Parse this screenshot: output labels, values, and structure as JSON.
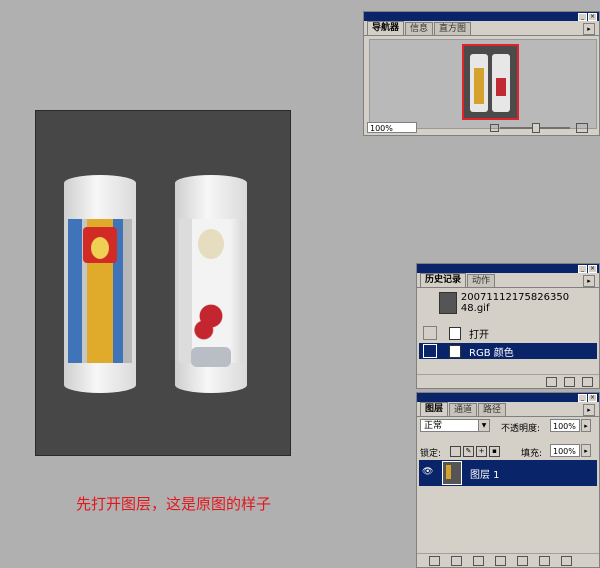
{
  "caption": "先打开图层，这是原图的样子",
  "navigator": {
    "tabs": [
      "导航器",
      "信息",
      "直方图"
    ],
    "zoom_value": "100%"
  },
  "history": {
    "tabs": [
      "历史记录",
      "动作"
    ],
    "snapshot_label": "20071112175826350​48.gif",
    "steps": [
      "打开",
      "RGB 颜色"
    ],
    "selected_step": "RGB 颜色"
  },
  "layers": {
    "tabs": [
      "图层",
      "通道",
      "路径"
    ],
    "blend_mode": "正常",
    "opacity_label": "不透明度:",
    "opacity_value": "100%",
    "lock_label": "锁定:",
    "fill_label": "填充:",
    "fill_value": "100%",
    "layer_name": "图层 1"
  },
  "colors": {
    "selection": "#0a246a",
    "caption": "#e3161b",
    "workspace": "#b0b0b0",
    "panel": "#d4d0c8"
  }
}
